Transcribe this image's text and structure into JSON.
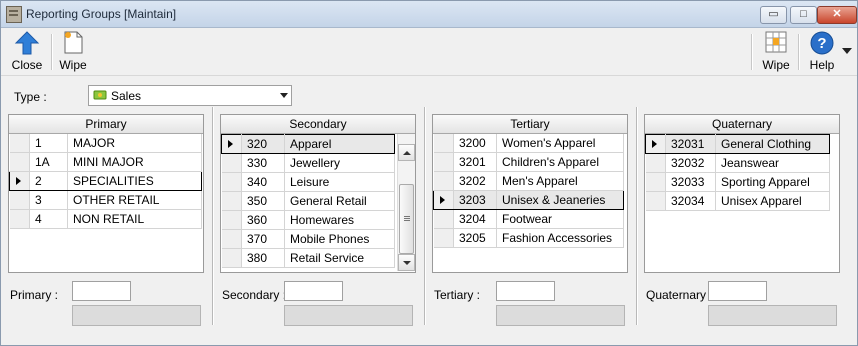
{
  "window": {
    "title": "Reporting Groups [Maintain]",
    "controls": {
      "minimize": "▭",
      "maximize": "□",
      "close": "✕"
    }
  },
  "toolbar": {
    "close_label": "Close",
    "wipe_label": "Wipe",
    "wipe2_label": "Wipe",
    "help_label": "Help"
  },
  "type": {
    "label": "Type :",
    "value": "Sales"
  },
  "primary": {
    "header": "Primary",
    "rows": [
      {
        "code": "1",
        "name": "MAJOR"
      },
      {
        "code": "1A",
        "name": "MINI MAJOR"
      },
      {
        "code": "2",
        "name": "SPECIALITIES"
      },
      {
        "code": "3",
        "name": "OTHER RETAIL"
      },
      {
        "code": "4",
        "name": "NON RETAIL"
      }
    ],
    "field_label": "Primary :"
  },
  "secondary": {
    "header": "Secondary",
    "rows": [
      {
        "code": "320",
        "name": "Apparel"
      },
      {
        "code": "330",
        "name": "Jewellery"
      },
      {
        "code": "340",
        "name": "Leisure"
      },
      {
        "code": "350",
        "name": "General Retail"
      },
      {
        "code": "360",
        "name": "Homewares"
      },
      {
        "code": "370",
        "name": "Mobile Phones"
      },
      {
        "code": "380",
        "name": "Retail Service"
      }
    ],
    "field_label": "Secondary :"
  },
  "tertiary": {
    "header": "Tertiary",
    "rows": [
      {
        "code": "3200",
        "name": "Women's Apparel"
      },
      {
        "code": "3201",
        "name": "Children's Apparel"
      },
      {
        "code": "3202",
        "name": "Men's Apparel"
      },
      {
        "code": "3203",
        "name": "Unisex & Jeaneries"
      },
      {
        "code": "3204",
        "name": "Footwear"
      },
      {
        "code": "3205",
        "name": "Fashion Accessories"
      }
    ],
    "field_label": "Tertiary :"
  },
  "quaternary": {
    "header": "Quaternary",
    "rows": [
      {
        "code": "32031",
        "name": "General Clothing"
      },
      {
        "code": "32032",
        "name": "Jeanswear"
      },
      {
        "code": "32033",
        "name": "Sporting Apparel"
      },
      {
        "code": "32034",
        "name": "Unisex Apparel"
      }
    ],
    "field_label": "Quaternary :"
  },
  "colors": {
    "close_icon": "#2f7fd8",
    "help_icon": "#2a6fc9",
    "window_bg": "#f0f0f0"
  }
}
